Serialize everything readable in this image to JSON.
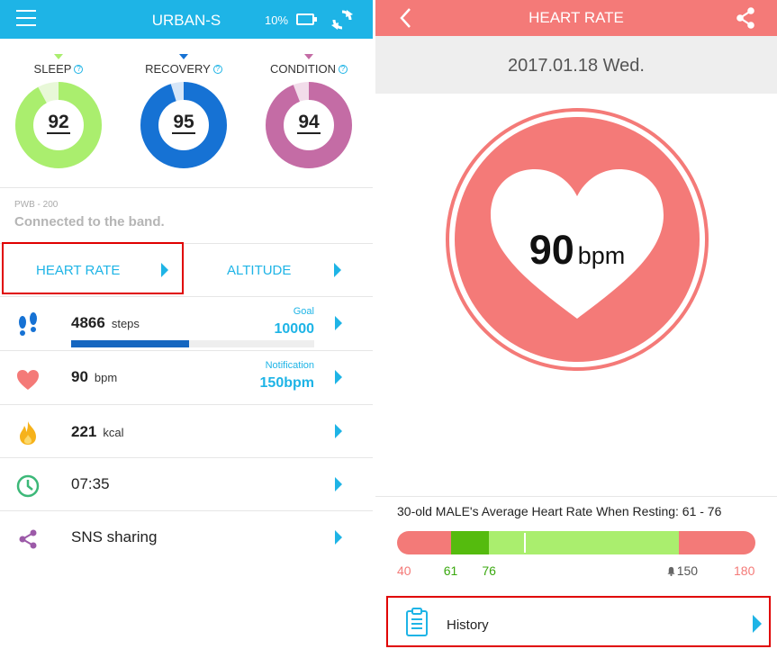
{
  "left": {
    "header": {
      "title": "URBAN-S",
      "battery": "10%"
    },
    "rings": [
      {
        "label": "SLEEP",
        "value": "92",
        "percent": 92,
        "color": "#aaee6e",
        "marker_color": "#aaee6e"
      },
      {
        "label": "RECOVERY",
        "value": "95",
        "percent": 95,
        "color": "#1672d4",
        "marker_color": "#1672d4"
      },
      {
        "label": "CONDITION",
        "value": "94",
        "percent": 94,
        "color": "#c46ca5",
        "marker_color": "#c46ca5"
      }
    ],
    "device": {
      "name": "PWB - 200",
      "status": "Connected to the band."
    },
    "tabs": {
      "heart_rate": "HEART RATE",
      "altitude": "ALTITUDE"
    },
    "rows": {
      "steps": {
        "value": "4866",
        "unit": "steps",
        "goal_label": "Goal",
        "goal_value": "10000",
        "progress": 0.487
      },
      "heart": {
        "value": "90",
        "unit": "bpm",
        "notify_label": "Notification",
        "notify_value": "150bpm"
      },
      "calories": {
        "value": "221",
        "unit": "kcal"
      },
      "time": {
        "value": "07:35"
      },
      "share": {
        "label": "SNS sharing"
      }
    }
  },
  "right": {
    "header": {
      "title": "HEART RATE"
    },
    "date": "2017.01.18 Wed.",
    "bpm": {
      "value": "90",
      "unit": "bpm"
    },
    "average_text": "30-old MALE's Average Heart Rate When Resting: 61 - 76",
    "scale": {
      "min": "40",
      "low": "61",
      "high": "76",
      "alert": "150",
      "max": "180",
      "current": 90
    },
    "history_label": "History",
    "colors": {
      "accent": "#f47a78",
      "blue": "#1eb4e6",
      "normal_zone": "#aaee6e",
      "rest_zone": "#55bb0e"
    }
  }
}
